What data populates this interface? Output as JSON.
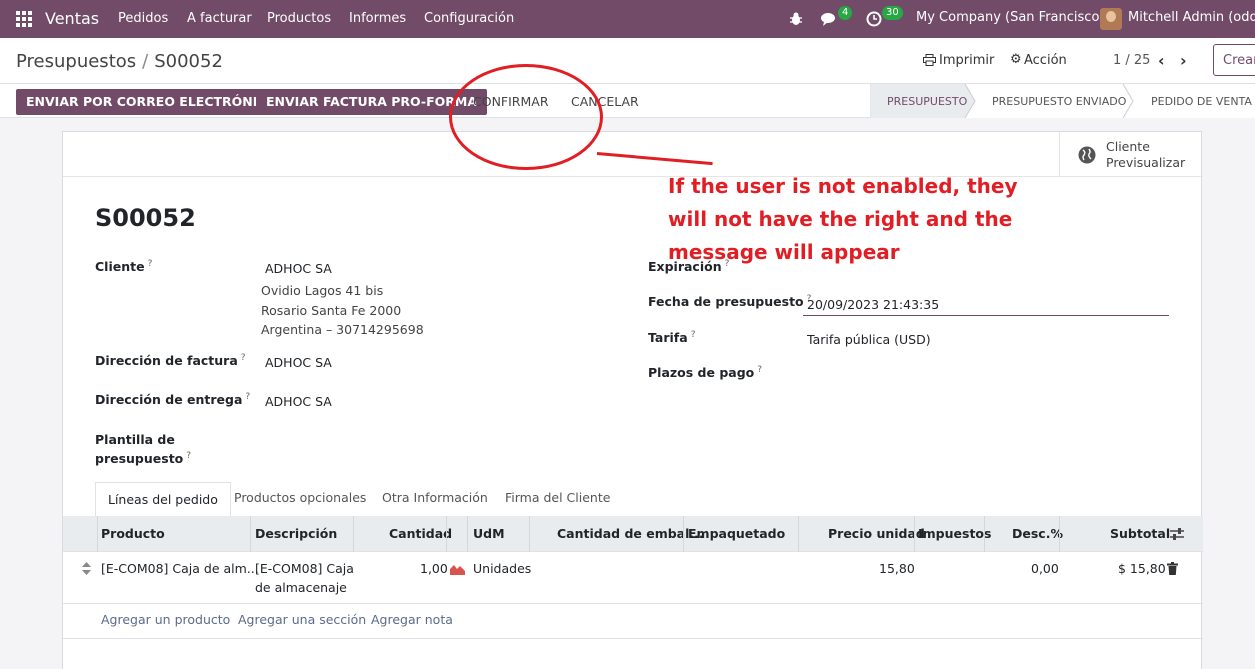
{
  "navbar": {
    "app_name": "Ventas",
    "menus": [
      "Pedidos",
      "A facturar",
      "Productos",
      "Informes",
      "Configuración"
    ],
    "chat_count": "4",
    "activity_count": "30",
    "company": "My Company (San Francisco)",
    "user": "Mitchell Admin (odoo"
  },
  "breadcrumb": {
    "parent": "Presupuestos",
    "sep": "/",
    "current": "S00052"
  },
  "toolbar": {
    "print_label": "Imprimir",
    "action_label": "Acción",
    "pager": "1 / 25",
    "create_label": "Crear"
  },
  "header_buttons": {
    "send_email": "ENVIAR POR CORREO ELECTRÓNICO",
    "send_proforma": "ENVIAR FACTURA PRO-FORMA",
    "confirm": "CONFIRMAR",
    "cancel": "CANCELAR"
  },
  "statusbar": [
    "PRESUPUESTO",
    "PRESUPUESTO ENVIADO",
    "PEDIDO DE VENTA"
  ],
  "preview": {
    "line1": "Cliente",
    "line2": "Previsualizar"
  },
  "form": {
    "name": "S00052",
    "customer_label": "Cliente",
    "customer": "ADHOC SA",
    "address1": "Ovidio Lagos 41 bis",
    "address2": "Rosario Santa Fe 2000",
    "address3": "Argentina – 30714295698",
    "invoice_label": "Dirección de factura",
    "invoice_value": "ADHOC SA",
    "delivery_label": "Dirección de entrega",
    "delivery_value": "ADHOC SA",
    "template_label_1": "Plantilla de",
    "template_label_2": "presupuesto",
    "expiration_label": "Expiración",
    "date_label": "Fecha de presupuesto",
    "date_value": "20/09/2023 21:43:35",
    "pricelist_label": "Tarifa",
    "pricelist_value": "Tarifa pública (USD)",
    "payment_label": "Plazos de pago"
  },
  "tabs": [
    "Líneas del pedido",
    "Productos opcionales",
    "Otra Información",
    "Firma del Cliente"
  ],
  "table": {
    "headers": [
      "Producto",
      "Descripción",
      "Cantidad",
      "UdM",
      "Cantidad de embal...",
      "Empaquetado",
      "Precio unidad",
      "Impuestos",
      "Desc.%",
      "Subtotal"
    ],
    "row": {
      "product": "[E-COM08] Caja de alm...",
      "desc1": "[E-COM08] Caja",
      "desc2": "de almacenaje",
      "qty": "1,00",
      "uom": "Unidades",
      "price": "15,80",
      "discount": "0,00",
      "subtotal": "$ 15,80"
    },
    "add_product": "Agregar un producto",
    "add_section": "Agregar una sección",
    "add_note": "Agregar nota"
  },
  "annotation": {
    "line1": "If the user is not enabled, they",
    "line2": "will not have the right and the",
    "line3": "message will appear",
    "color": "#e01e24"
  }
}
